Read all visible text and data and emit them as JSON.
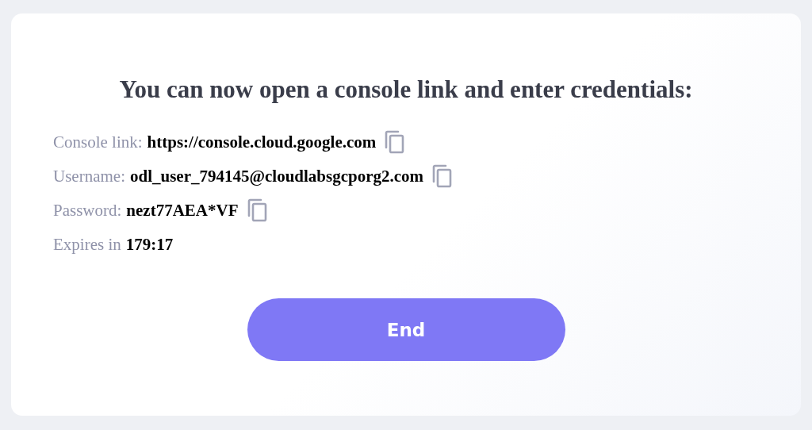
{
  "heading": "You can now open a console link and enter credentials:",
  "fields": [
    {
      "label": "Console link:",
      "value": "https://console.cloud.google.com",
      "copyable": true
    },
    {
      "label": "Username:",
      "value": "odl_user_794145@cloudlabsgcporg2.com",
      "copyable": true
    },
    {
      "label": "Password:",
      "value": "nezt77AEA*VF",
      "copyable": true
    },
    {
      "label": "Expires in",
      "value": "179:17",
      "copyable": false
    }
  ],
  "button": "End"
}
